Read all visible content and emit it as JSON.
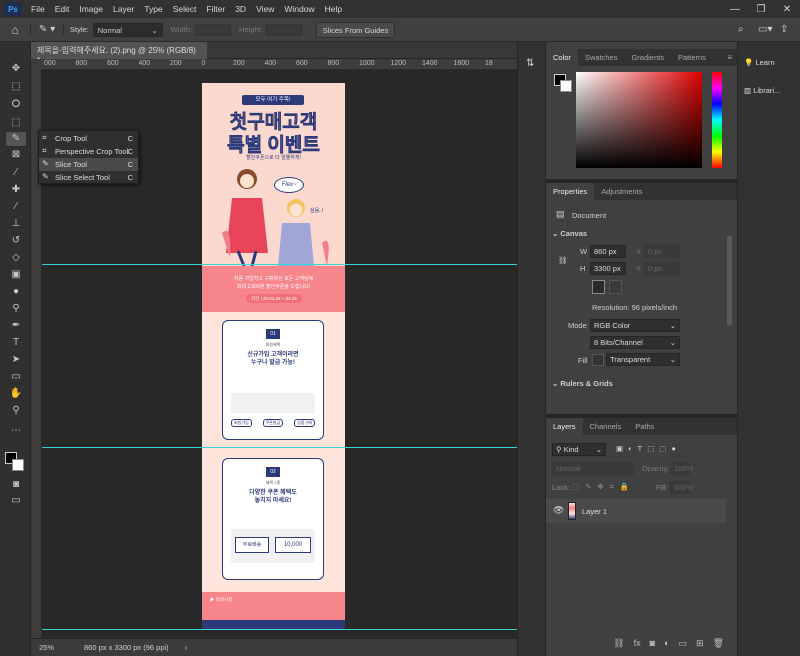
{
  "app": {
    "logo": "Ps",
    "menu": [
      "File",
      "Edit",
      "Image",
      "Layer",
      "Type",
      "Select",
      "Filter",
      "3D",
      "View",
      "Window",
      "Help"
    ],
    "window_controls": [
      "—",
      "❐",
      "✕"
    ]
  },
  "options": {
    "style_label": "Style:",
    "style_value": "Normal",
    "width_label": "Width:",
    "height_label": "Height:",
    "slices_button": "Slices From Guides"
  },
  "document": {
    "tab_title": "제목을-입력해주세요. (2).png @ 25% (RGB/8) *",
    "zoom": "25%",
    "info": "860 px x 3300 px (96 ppi)"
  },
  "ruler": {
    "ticks": [
      "000",
      "800",
      "600",
      "400",
      "200",
      "0",
      "200",
      "400",
      "600",
      "800",
      "1000",
      "1200",
      "1400",
      "1600",
      "18"
    ]
  },
  "flyout": [
    {
      "label": "Crop Tool",
      "shortcut": "C",
      "icon": "crop-icon"
    },
    {
      "label": "Perspective Crop Tool",
      "shortcut": "C",
      "icon": "perspective-crop-icon"
    },
    {
      "label": "Slice Tool",
      "shortcut": "C",
      "icon": "slice-icon"
    },
    {
      "label": "Slice Select Tool",
      "shortcut": "C",
      "icon": "slice-select-icon"
    }
  ],
  "artwork": {
    "badge": "모두 여기 주목!",
    "headline1": "첫구매",
    "headline1b": "고객",
    "headline2": "특별 이벤트",
    "subhead": "할인쿠폰으로 더 알뜰하게!",
    "flex": "Flex~",
    "aside": "살음..!",
    "band_line1": "처음 가입하고 구매하신 모든 고객님께",
    "band_line2": "최대 2,000원 할인쿠폰을 드립니다!",
    "band_period": "기간 | 20.03.26 ~ 04.25",
    "card1_num": "01",
    "card1_tag": "회원혜택",
    "card1_title": "신규가입 고객이라면",
    "card1_title2": "누구나 발급 가능!",
    "card1_steps": [
      "회원가입",
      "쿠폰발급",
      "상품구매"
    ],
    "card2_num": "02",
    "card2_tag": "혜택 1종",
    "card2_title": "다양한 쿠폰 혜택도",
    "card2_title2": "놓치지 마세요!",
    "coupon1": "무료배송",
    "coupon2": "10,000",
    "notice_title": "▶ 유의사항"
  },
  "color_panel": {
    "tabs": [
      "Color",
      "Swatches",
      "Gradients",
      "Patterns"
    ]
  },
  "properties": {
    "tabs": [
      "Properties",
      "Adjustments"
    ],
    "doc_label": "Document",
    "canvas_header": "Canvas",
    "w_label": "W",
    "w_value": "860 px",
    "x_label": "X",
    "x_value": "0 px",
    "h_label": "H",
    "h_value": "3300 px",
    "y_label": "Y",
    "y_value": "0 px",
    "resolution": "Resolution: 96 pixels/inch",
    "mode_label": "Mode",
    "mode_value": "RGB Color",
    "depth_value": "8 Bits/Channel",
    "fill_label": "Fill",
    "fill_value": "Transparent",
    "rulers_header": "Rulers & Grids"
  },
  "layers": {
    "tabs": [
      "Layers",
      "Channels",
      "Paths"
    ],
    "kind": "Kind",
    "blend": "Normal",
    "opacity_label": "Opacity:",
    "opacity_value": "100%",
    "lock_label": "Lock:",
    "fill_label": "Fill:",
    "fill_value": "100%",
    "layer_name": "Layer 1"
  },
  "side": {
    "learn": "Learn",
    "libraries": "Librari..."
  },
  "colors": {
    "accent_pink": "#f07f8a",
    "band_pink": "#f6868c",
    "navy": "#2c3a7a",
    "guide": "#3ad1d1"
  }
}
